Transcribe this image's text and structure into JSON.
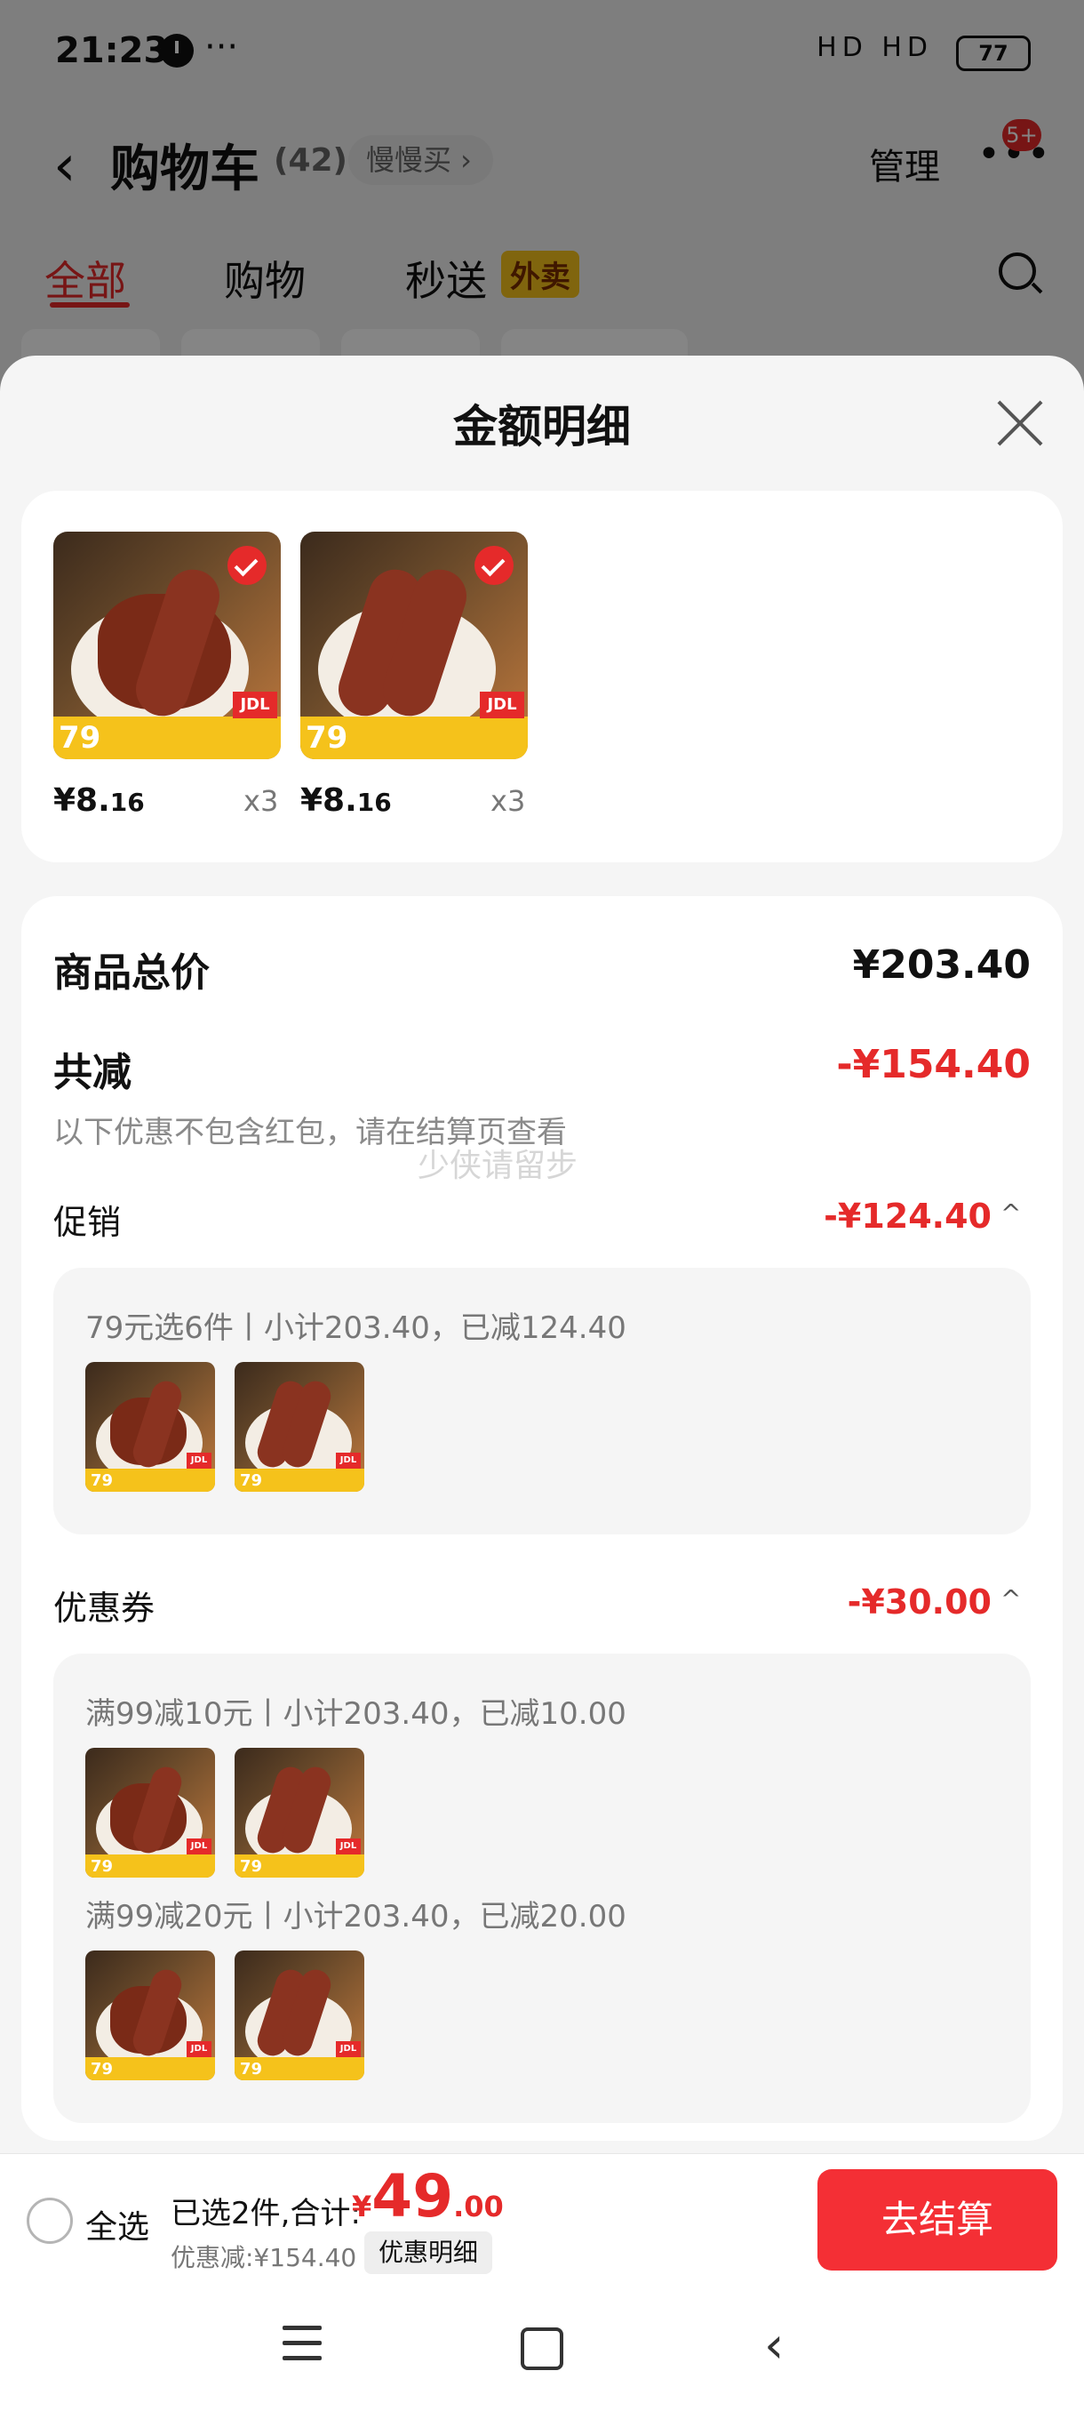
{
  "status": {
    "time": "21:23",
    "more": "···",
    "signal_icons": "HD HD",
    "battery": "77"
  },
  "header": {
    "title": "购物车",
    "count": "(42)",
    "slow_buy": "慢慢买 ›",
    "manage": "管理",
    "badge": "5+"
  },
  "tabs": [
    {
      "label": "全部"
    },
    {
      "label": "购物"
    },
    {
      "label": "秒送"
    }
  ],
  "tab_badge": "外卖",
  "sheet": {
    "title": "金额明细",
    "items": [
      {
        "price_int": "¥8.",
        "price_dec": "16",
        "qty": "x3"
      },
      {
        "price_int": "¥8.",
        "price_dec": "16",
        "qty": "x3"
      }
    ],
    "thumb_badge": "79",
    "thumb_jdl": "JDL",
    "total_label": "商品总价",
    "total_value": "¥203.40",
    "reduce_label": "共减",
    "reduce_value": "-¥154.40",
    "reduce_note": "以下优惠不包含红包，请在结算页查看",
    "watermark": "少侠请留步",
    "promo": {
      "label": "促销",
      "value": "-¥124.40",
      "lines": [
        "79元选6件丨小计203.40，已减124.40"
      ]
    },
    "coupon": {
      "label": "优惠券",
      "value": "-¥30.00",
      "lines": [
        "满99减10元丨小计203.40，已减10.00",
        "满99减20元丨小计203.40，已减20.00"
      ]
    },
    "caret": "^"
  },
  "bottom": {
    "select_all": "全选",
    "selected": "已选2件,合计:",
    "yen": "¥",
    "total_big": "49",
    "total_cents": ".00",
    "discount": "优惠减:¥154.40",
    "detail_button": "优惠明细",
    "checkout": "去结算"
  },
  "nav": {
    "back": "‹"
  },
  "colors": {
    "accent": "#e52a2a",
    "checkout_bg": "#f42f35",
    "badge_yellow": "#f5c21b"
  }
}
